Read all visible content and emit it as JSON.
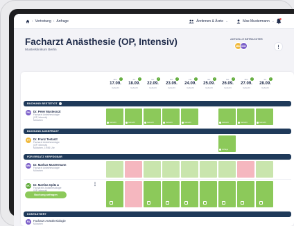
{
  "nav": {
    "breadcrumb": [
      "Vertretung",
      "Anfrage"
    ],
    "doctors_menu": "Ärztinnen & Ärzte",
    "user_menu": "Max Mustermann",
    "notification_count": "1"
  },
  "header": {
    "title": "Facharzt Anästhesie (OP, Intensiv)",
    "subtitle": "Musterklinikum Berlin",
    "viewers_label": "AKTUELLE BETRACHTER",
    "viewer_avatars": [
      "MM",
      "MO"
    ]
  },
  "days": [
    {
      "weekday": "MO.",
      "date": "17.09.",
      "status": "Gebucht"
    },
    {
      "weekday": "DI.",
      "date": "18.09.",
      "status": "Gebucht"
    },
    {
      "weekday": "MI.",
      "date": "22.09.",
      "status": "Gebucht"
    },
    {
      "weekday": "DO.",
      "date": "23.09.",
      "status": "Gebucht"
    },
    {
      "weekday": "FR.",
      "date": "24.09.",
      "status": "Gebucht"
    },
    {
      "weekday": "SA.",
      "date": "25.09.",
      "status": "Gebucht"
    },
    {
      "weekday": "SO.",
      "date": "26.09.",
      "status": "Gebucht"
    },
    {
      "weekday": "MO.",
      "date": "27.09.",
      "status": "Gebucht"
    },
    {
      "weekday": "DI.",
      "date": "28.09.",
      "status": "Gebucht"
    }
  ],
  "sections": {
    "confirmed": "BUCHUNG BESTÄTIGT",
    "offered": "BUCHUNG ANGEFRAGT",
    "available": "FÜR ERSATZ VERFÜGBAR",
    "contacted": "KONTAKTIERT"
  },
  "people": {
    "peter": {
      "initials": "PM",
      "name": "Dr. Peter Musterarzt",
      "desc": [
        "Facharzt Anästhesiologie",
        "(OP, Intensiv)",
        "München"
      ]
    },
    "franz": {
      "initials": "FT",
      "name": "Dr. Franz Testarzt",
      "desc": [
        "Facharzt Anästhesiologie",
        "(OP, Intensiv)",
        "München, 19:56 Uhr"
      ]
    },
    "markus": {
      "initials": "MM",
      "name": "Dr. Markus Mustermann",
      "desc": [
        "Facharzt Anästhesiologie",
        "München"
      ]
    },
    "martina": {
      "initials": "MO",
      "name": "Dr. Martina Opitz",
      "desc": [
        "Fachärztin Anästhesiologie",
        "(OP, Intensiv)",
        "München"
      ]
    },
    "contact": {
      "initials": "FA",
      "name": "Facharzt Anästhesiologie",
      "desc": [
        "München"
      ]
    }
  },
  "cell_labels": {
    "booked": "Gebucht",
    "request": "Anfrage"
  },
  "buttons": {
    "request_booking": "Buchung anfragen"
  },
  "colors": {
    "green": "#8cc95a",
    "light_green": "#c9e5ad",
    "pink": "#f5b7bf",
    "navy": "#1f3a5a"
  }
}
